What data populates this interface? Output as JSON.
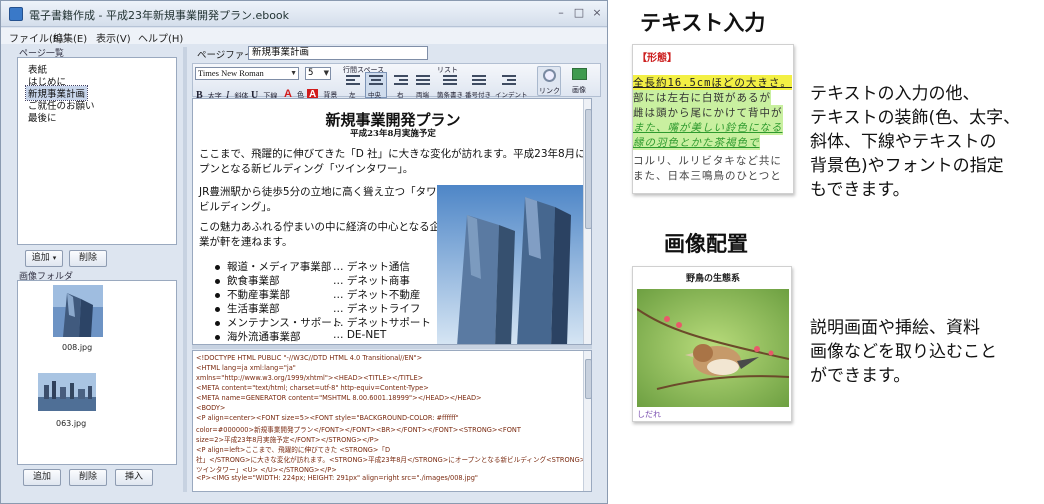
{
  "window": {
    "title": "電子書籍作成 - 平成23年新規事業開発プラン.ebook",
    "controls": {
      "minimize": "–",
      "maximize": "□",
      "close": "×"
    }
  },
  "menu": [
    "ファイル(F)",
    "編集(E)",
    "表示(V)",
    "ヘルプ(H)"
  ],
  "page_list": {
    "heading": "ページ一覧",
    "items": [
      "表紙",
      "はじめに",
      "新規事業計画",
      "ご就任のお願い",
      "最後に"
    ],
    "selected_index": 2,
    "add_button": "追加",
    "delete_button": "削除"
  },
  "image_folder": {
    "heading": "画像フォルダ",
    "images": [
      "008.jpg",
      "063.jpg"
    ],
    "add_button": "追加",
    "delete_button": "削除",
    "insert_button": "挿入"
  },
  "editor": {
    "filename_label": "ページファイル名",
    "filename_value": "新規事業計画",
    "toolbar": {
      "font": "Times New Roman",
      "size": "5",
      "line_spacing_label": "行間スペース",
      "list_label": "リスト",
      "bold": "太字",
      "italic": "斜体",
      "underline": "下線",
      "color": "色",
      "bgcolor": "背景",
      "align_left": "左",
      "align_center": "中央",
      "align_right": "右",
      "justify": "両端",
      "list_bullet": "箇条書き",
      "list_number": "番号付き",
      "indent": "インデント",
      "link": "リンク",
      "image": "画像"
    },
    "document": {
      "title": "新規事業開発プラン",
      "subtitle": "平成23年8月実施予定",
      "para1_a": "ここまで、飛躍的に伸びてきた「D 社」に大きな変化が訪れます。平成23年8月にオー",
      "para1_b": "プンとなる新ビルディング「ツインタワー」。",
      "para2_a": "JR豊洲駅から徒歩5分の立地に高く聳え立つ「タワー",
      "para2_b": "ビルディング」。",
      "para3_a": "この魅力あふれる佇まいの中に経済の中心となる企",
      "para3_b": "業が軒を連ねます。",
      "departments": [
        {
          "name": "報道・メディア事業部",
          "company": "…  デネット通信"
        },
        {
          "name": "飲食事業部",
          "company": "…  デネット商事"
        },
        {
          "name": "不動産事業部",
          "company": "…  デネット不動産"
        },
        {
          "name": "生活事業部",
          "company": "…  デネットライフ"
        },
        {
          "name": "メンテナンス・サポート",
          "company": "…  デネットサポート"
        },
        {
          "name": "海外流通事業部",
          "company": "…  DE-NET"
        }
      ]
    },
    "source_lines": [
      "<!DOCTYPE HTML PUBLIC \"-//W3C//DTD HTML 4.0 Transitional//EN\">",
      "<HTML lang=ja xml:lang=\"ja\"",
      "xmlns=\"http://www.w3.org/1999/xhtml\"><HEAD><TITLE></TITLE>",
      "<META content=\"text/html; charset=utf-8\" http-equiv=Content-Type>",
      "<META name=GENERATOR content=\"MSHTML 8.00.6001.18999\"></HEAD></HEAD>",
      "<BODY>",
      "<P align=center><FONT size=5><FONT style=\"BACKGROUND-COLOR: #ffffff\"",
      "color=#000000>新規事業開発プラン</FONT></FONT><BR></FONT></FONT><STRONG><FONT",
      "size=2>平成23年8月実施予定</FONT></STRONG></P>",
      "<P align=left>ここまで、飛躍的に伸びてきた <STRONG>「D",
      "社」</STRONG>に大きな変化が訪れます。<STRONG>平成23年8月</STRONG>にオープンとなる新ビルディング<STRONG>「",
      "ツインタワー」<U> </U></STRONG></P>",
      "<P><IMG style=\"WIDTH: 224px; HEIGHT: 291px\" align=right src=\"./images/008.jpg\""
    ]
  },
  "feature_text": {
    "heading": "テキスト入力",
    "sample_label": "【形態】",
    "sample_lines": [
      "全長約16.5cmほどの大きさ。",
      "部には左右に白斑があるが",
      "雌は頭から尾にかけて背中が",
      "また、嘴が美しい鈴色になる",
      "縁の羽色とかた茶褐色で",
      "コルリ、ルリビタキなど共に",
      "また、日本三鳴鳥のひとつと"
    ],
    "description": [
      "テキストの入力の他、",
      "テキストの装飾(色、太字、",
      "斜体、下線やテキストの",
      "背景色)やフォントの指定",
      "もできます。"
    ]
  },
  "feature_image": {
    "heading": "画像配置",
    "card_title": "野鳥の生態系",
    "card_caption": "しだれ",
    "description": [
      "説明画面や挿絵、資料",
      "画像などを取り込むこと",
      "ができます。"
    ]
  },
  "colors": {
    "accent_red": "#cc1f1f",
    "highlight_yellow": "#f3f044",
    "highlight_green": "#c9f0a0",
    "link_green": "#2e9a2e",
    "source_text": "#7a2a10"
  }
}
